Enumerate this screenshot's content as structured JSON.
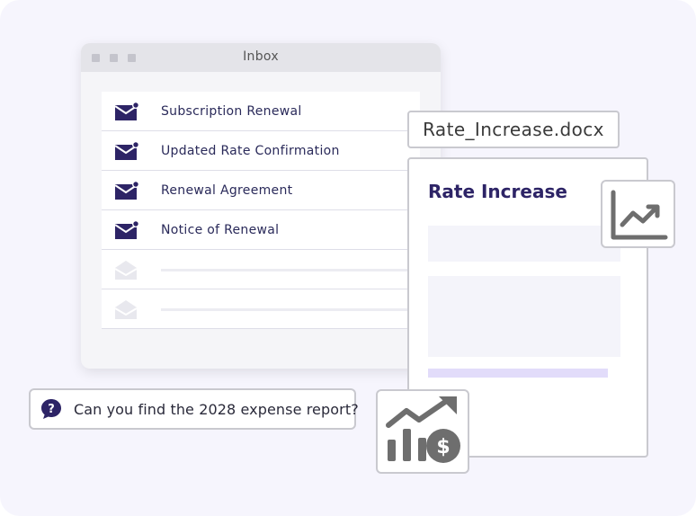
{
  "window": {
    "title": "Inbox"
  },
  "inbox": {
    "items": [
      {
        "label": "Subscription Renewal",
        "icon": "unread-mail-icon",
        "unread": true
      },
      {
        "label": "Updated Rate Confirmation",
        "icon": "unread-mail-icon",
        "unread": true
      },
      {
        "label": "Renewal Agreement",
        "icon": "unread-mail-icon",
        "unread": true
      },
      {
        "label": "Notice of Renewal",
        "icon": "unread-mail-icon",
        "unread": true
      },
      {
        "label": "",
        "icon": "open-mail-icon",
        "unread": false
      },
      {
        "label": "",
        "icon": "open-mail-icon",
        "unread": false
      }
    ]
  },
  "document": {
    "filename": "Rate_Increase.docx",
    "title": "Rate Increase"
  },
  "prompt": {
    "text": "Can you find the 2028 expense report?"
  },
  "icons": {
    "chart": "line-chart-icon",
    "finance": "revenue-growth-icon",
    "question": "question-bubble-icon"
  },
  "colors": {
    "brand": "#2d2466",
    "mail_icon": "#2d2466",
    "muted_icon": "#e8e8ee",
    "accent_bar": "#e2dcfa",
    "icon_gray": "#6e6e6e"
  }
}
